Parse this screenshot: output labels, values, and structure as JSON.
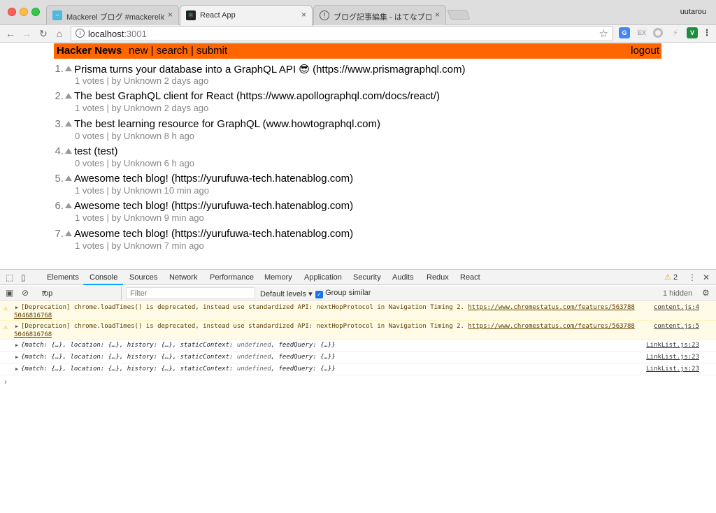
{
  "browser": {
    "tabs": [
      {
        "title": "Mackerel ブログ #mackerelio",
        "icon": "mackerel-icon",
        "active": false
      },
      {
        "title": "React App",
        "icon": "react-icon",
        "active": true
      },
      {
        "title": "ブログ記事編集 - はてなブログ",
        "icon": "hatena-icon",
        "active": false
      }
    ],
    "tab_close": "×",
    "profile_name": "uutarou",
    "url_host": "localhost",
    "url_port": ":3001"
  },
  "hn": {
    "brand": "Hacker News",
    "nav": "new | search | submit",
    "logout": "logout",
    "accent_color": "#ff6600",
    "links": [
      {
        "rank": "1.",
        "title": "Prisma turns your database into a GraphQL API 😎  (https://www.prismagraphql.com)",
        "meta": "1 votes | by Unknown 2 days ago"
      },
      {
        "rank": "2.",
        "title": "The best GraphQL client for React (https://www.apollographql.com/docs/react/)",
        "meta": "1 votes | by Unknown 2 days ago"
      },
      {
        "rank": "3.",
        "title": "The best learning resource for GraphQL (www.howtographql.com)",
        "meta": "0 votes | by Unknown 8 h ago"
      },
      {
        "rank": "4.",
        "title": "test (test)",
        "meta": "0 votes | by Unknown 6 h ago"
      },
      {
        "rank": "5.",
        "title": "Awesome tech blog! (https://yurufuwa-tech.hatenablog.com)",
        "meta": "1 votes | by Unknown 10 min ago"
      },
      {
        "rank": "6.",
        "title": "Awesome tech blog! (https://yurufuwa-tech.hatenablog.com)",
        "meta": "1 votes | by Unknown 9 min ago"
      },
      {
        "rank": "7.",
        "title": "Awesome tech blog! (https://yurufuwa-tech.hatenablog.com)",
        "meta": "1 votes | by Unknown 7 min ago"
      }
    ]
  },
  "devtools": {
    "tabs": [
      "Elements",
      "Console",
      "Sources",
      "Network",
      "Performance",
      "Memory",
      "Application",
      "Security",
      "Audits",
      "Redux",
      "React"
    ],
    "active_tab": "Console",
    "warning_count": "2",
    "context": "top",
    "filter_placeholder": "Filter",
    "levels": "Default levels ▾",
    "group_similar": "Group similar",
    "hidden": "1 hidden",
    "messages": [
      {
        "type": "warn",
        "text": "[Deprecation] chrome.loadTimes() is deprecated, instead use standardized API: nextHopProtocol in Navigation Timing 2. ",
        "url": "https://www.chromestatus.com/features/563788",
        "url_cont": "5046816768",
        "source": "content.js:4"
      },
      {
        "type": "warn",
        "text": "[Deprecation] chrome.loadTimes() is deprecated, instead use standardized API: nextHopProtocol in Navigation Timing 2. ",
        "url": "https://www.chromestatus.com/features/563788",
        "url_cont": "5046816768",
        "source": "content.js:5"
      },
      {
        "type": "log",
        "text": "{match: {…}, location: {…}, history: {…}, staticContext: ",
        "undef": "undefined",
        "text_end": ", feedQuery: {…}}",
        "source": "LinkList.js:23"
      },
      {
        "type": "log",
        "text": "{match: {…}, location: {…}, history: {…}, staticContext: ",
        "undef": "undefined",
        "text_end": ", feedQuery: {…}}",
        "source": "LinkList.js:23"
      },
      {
        "type": "log",
        "text": "{match: {…}, location: {…}, history: {…}, staticContext: ",
        "undef": "undefined",
        "text_end": ", feedQuery: {…}}",
        "source": "LinkList.js:23"
      }
    ],
    "prompt": "›"
  }
}
